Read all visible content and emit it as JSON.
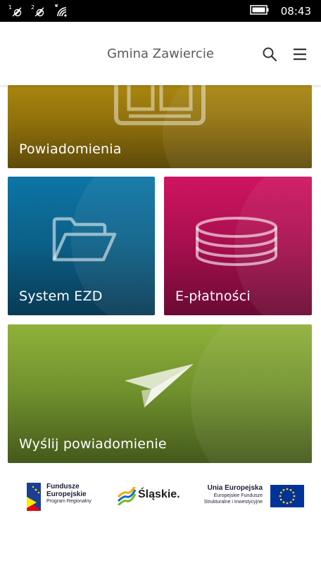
{
  "status_bar": {
    "time": "08:43",
    "sim1_label": "1",
    "sim2_label": "2",
    "battery": "battery-icon",
    "wifi": "wifi-icon"
  },
  "header": {
    "title": "Gmina Zawiercie",
    "search_icon": "search-icon",
    "menu_icon": "hamburger-menu-icon"
  },
  "tiles": [
    {
      "label": "Powiadomienia",
      "icon": "newspaper-icon",
      "color": "#a9860f"
    },
    {
      "label": "System EZD",
      "icon": "folder-icon",
      "color": "#0d75a6"
    },
    {
      "label": "E-płatności",
      "icon": "coins-icon",
      "color": "#d01461"
    },
    {
      "label": "Wyślij powiadomienie",
      "icon": "paper-plane-icon",
      "color": "#8fb13a"
    }
  ],
  "footer": {
    "fe": {
      "line1": "Fundusze",
      "line2": "Europejskie",
      "line3": "Program Regionalny"
    },
    "slaskie": {
      "text": "Śląskie."
    },
    "eu": {
      "line1": "Unia Europejska",
      "line2": "Europejskie Fundusze",
      "line3": "Strukturalne i Inwestycyjne"
    }
  }
}
